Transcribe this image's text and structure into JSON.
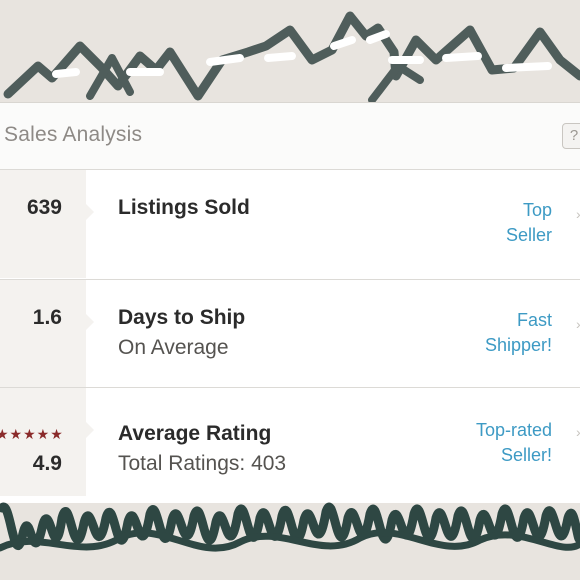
{
  "header": {
    "title": "Sales Analysis",
    "help_label": "?"
  },
  "rows": [
    {
      "value": "639",
      "label": "Listings Sold",
      "sublabel": "",
      "badge_line1": "Top",
      "badge_line2": "Seller"
    },
    {
      "value": "1.6",
      "label": "Days to Ship",
      "sublabel": "On Average",
      "badge_line1": "Fast",
      "badge_line2": "Shipper!"
    },
    {
      "value": "4.9",
      "label": "Average Rating",
      "sublabel": "Total Ratings: 403",
      "badge_line1": "Top-rated",
      "badge_line2": "Seller!",
      "stars": "★★★★★"
    }
  ],
  "colors": {
    "accent_link": "#3d9ac4",
    "star": "#8a2a2a",
    "doodle": "#4f5d5b",
    "scribble": "#2e4743"
  }
}
